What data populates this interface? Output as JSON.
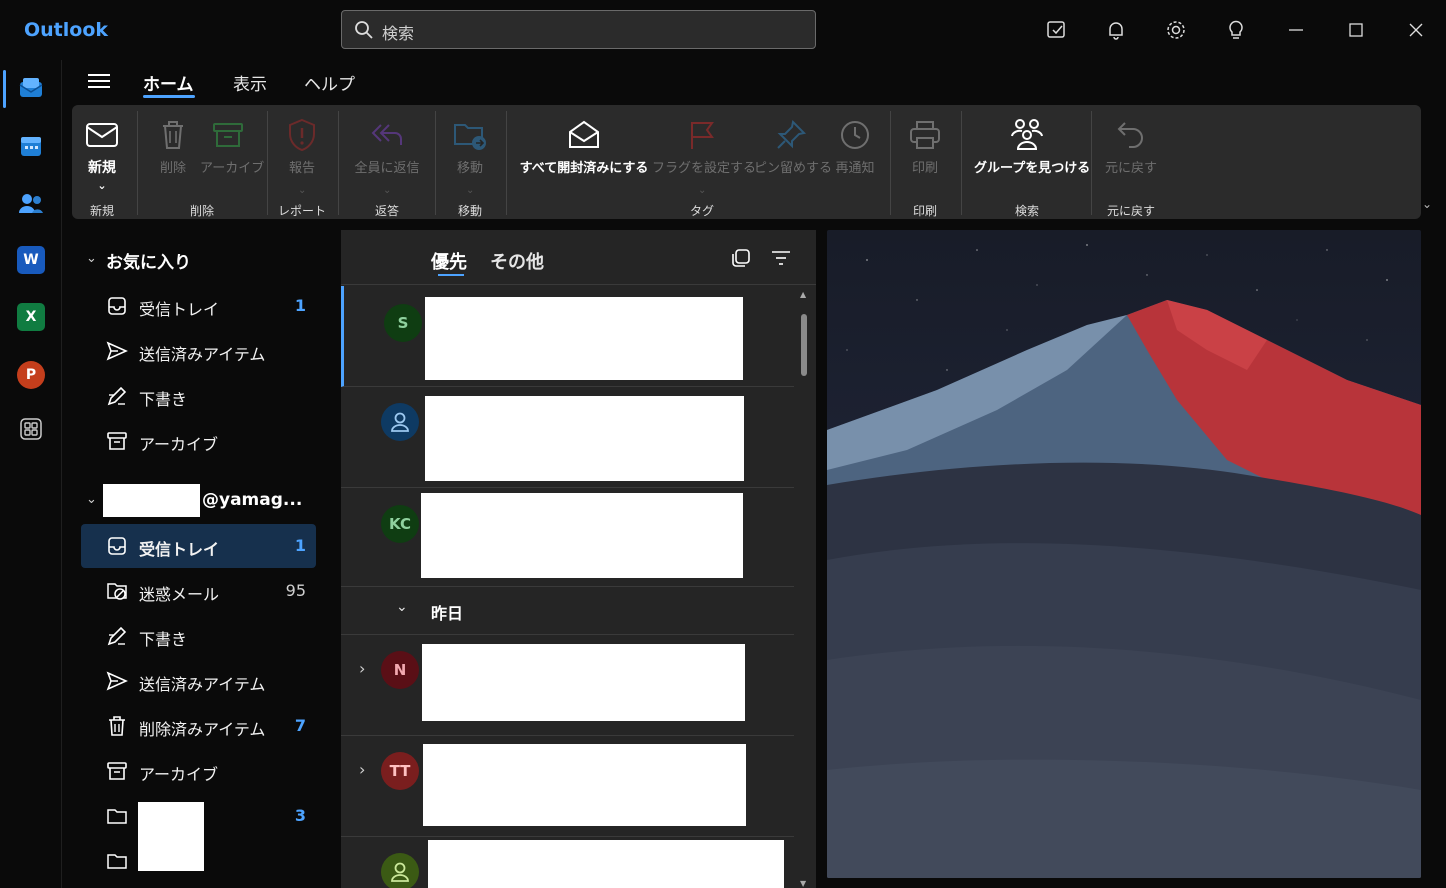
{
  "app": {
    "title": "Outlook"
  },
  "search": {
    "placeholder": "検索"
  },
  "titlebar_icons": [
    "compose-note-icon",
    "bell-icon",
    "gear-icon",
    "lightbulb-icon",
    "minimize-icon",
    "maximize-icon",
    "close-icon"
  ],
  "rail": [
    {
      "name": "mail",
      "icon": "mail-icon",
      "active": true
    },
    {
      "name": "calendar",
      "icon": "calendar-icon"
    },
    {
      "name": "people",
      "icon": "people-icon"
    },
    {
      "name": "word",
      "icon": "word-icon",
      "letter": "W"
    },
    {
      "name": "excel",
      "icon": "excel-icon",
      "letter": "X"
    },
    {
      "name": "powerpoint",
      "icon": "powerpoint-icon",
      "letter": "P"
    },
    {
      "name": "apps",
      "icon": "apps-icon"
    }
  ],
  "menu_tabs": [
    "ホーム",
    "表示",
    "ヘルプ"
  ],
  "ribbon": {
    "new_label": "新規",
    "delete_label": "削除",
    "archive_label": "アーカイブ",
    "report_label": "報告",
    "reply_all_label": "全員に返信",
    "move_label": "移動",
    "mark_all_read_label": "すべて開封済みにする",
    "flag_label": "フラグを設定する",
    "pin_label": "ピン留めする",
    "snooze_label": "再通知",
    "print_label": "印刷",
    "groups_label": "グループを見つける",
    "undo_label": "元に戻す",
    "groups": {
      "new": "新規",
      "delete": "削除",
      "report": "レポート",
      "respond": "返答",
      "move": "移動",
      "tags": "タグ",
      "print": "印刷",
      "find": "検索",
      "undo": "元に戻す"
    }
  },
  "favorites": {
    "header": "お気に入り",
    "items": [
      {
        "label": "受信トレイ",
        "count": "1",
        "icon": "inbox-icon"
      },
      {
        "label": "送信済みアイテム",
        "count": "",
        "icon": "send-icon"
      },
      {
        "label": "下書き",
        "count": "",
        "icon": "draft-icon"
      },
      {
        "label": "アーカイブ",
        "count": "",
        "icon": "archive-icon"
      }
    ]
  },
  "account": {
    "header_suffix": "@yamag...",
    "items": [
      {
        "label": "受信トレイ",
        "count": "1",
        "icon": "inbox-icon"
      },
      {
        "label": "迷惑メール",
        "count": "95",
        "icon": "junk-icon"
      },
      {
        "label": "下書き",
        "count": "",
        "icon": "draft-icon"
      },
      {
        "label": "送信済みアイテム",
        "count": "",
        "icon": "send-icon"
      },
      {
        "label": "削除済みアイテム",
        "count": "7",
        "icon": "trash-icon"
      },
      {
        "label": "アーカイブ",
        "count": "",
        "icon": "archive-icon"
      },
      {
        "label": "",
        "count": "3",
        "icon": "folder-icon"
      },
      {
        "label": "",
        "count": "",
        "icon": "folder-icon"
      }
    ]
  },
  "message_list": {
    "tabs": [
      "優先",
      "その他"
    ],
    "section_yesterday": "昨日",
    "rows": [
      {
        "initials": "S",
        "avatar_bg": "#0f3d12",
        "avatar_fg": "#8fd19e"
      },
      {
        "initials": "",
        "avatar_bg": "#0e3a63",
        "avatar_fg": "#9cc8f0",
        "icon": "person-icon"
      },
      {
        "initials": "KC",
        "avatar_bg": "#0f3d12",
        "avatar_fg": "#8fd19e"
      },
      {
        "initials": "N",
        "avatar_bg": "#5a0f16",
        "avatar_fg": "#f2a9b0"
      },
      {
        "initials": "TT",
        "avatar_bg": "#7a1e1e",
        "avatar_fg": "#ffc0c0"
      },
      {
        "initials": "",
        "avatar_bg": "#3b5a14",
        "avatar_fg": "#cbe89a",
        "icon": "person-icon"
      }
    ]
  },
  "colors": {
    "accent": "#4da3ff",
    "ribbon_bg": "#2b2b2b",
    "selected_bg": "#16304d"
  }
}
